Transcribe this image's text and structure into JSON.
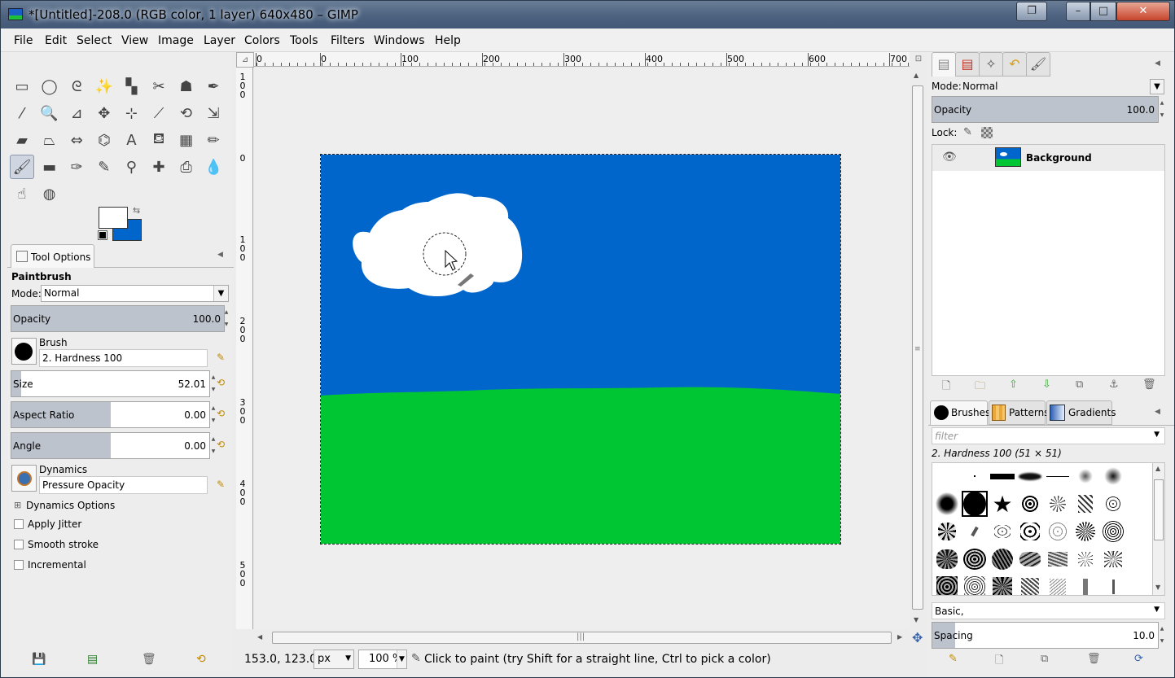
{
  "window": {
    "title": "*[Untitled]-208.0 (RGB color, 1 layer) 640x480 – GIMP",
    "buttons": {
      "restore": "❐",
      "minimize": "–",
      "maximize": "□",
      "close": "✕"
    }
  },
  "menubar": {
    "items": [
      "File",
      "Edit",
      "Select",
      "View",
      "Image",
      "Layer",
      "Colors",
      "Tools",
      "Filters",
      "Windows",
      "Help"
    ]
  },
  "toolbox": {
    "tools": [
      {
        "name": "rect-select-icon",
        "glyph": "▭"
      },
      {
        "name": "ellipse-select-icon",
        "glyph": "◯"
      },
      {
        "name": "free-select-icon",
        "glyph": "ᘓ"
      },
      {
        "name": "fuzzy-select-icon",
        "glyph": "✨"
      },
      {
        "name": "select-by-color-icon",
        "glyph": "▚"
      },
      {
        "name": "scissors-select-icon",
        "glyph": "✂"
      },
      {
        "name": "foreground-select-icon",
        "glyph": "☗"
      },
      {
        "name": "paths-icon",
        "glyph": "✒"
      },
      {
        "name": "color-picker-icon",
        "glyph": "⁄"
      },
      {
        "name": "zoom-icon",
        "glyph": "🔍"
      },
      {
        "name": "measure-icon",
        "glyph": "⊿"
      },
      {
        "name": "move-icon",
        "glyph": "✥"
      },
      {
        "name": "align-icon",
        "glyph": "⊹"
      },
      {
        "name": "crop-icon",
        "glyph": "⟋"
      },
      {
        "name": "rotate-icon",
        "glyph": "⟲"
      },
      {
        "name": "scale-icon",
        "glyph": "⇲"
      },
      {
        "name": "shear-icon",
        "glyph": "▰"
      },
      {
        "name": "perspective-icon",
        "glyph": "⏢"
      },
      {
        "name": "flip-icon",
        "glyph": "⇔"
      },
      {
        "name": "cage-transform-icon",
        "glyph": "⌬"
      },
      {
        "name": "text-icon",
        "glyph": "A"
      },
      {
        "name": "bucket-fill-icon",
        "glyph": "⛾"
      },
      {
        "name": "blend-icon",
        "glyph": "▦"
      },
      {
        "name": "pencil-icon",
        "glyph": "✏"
      },
      {
        "name": "paintbrush-icon",
        "glyph": "🖌"
      },
      {
        "name": "eraser-icon",
        "glyph": "▬"
      },
      {
        "name": "airbrush-icon",
        "glyph": "✑"
      },
      {
        "name": "ink-icon",
        "glyph": "✎"
      },
      {
        "name": "clone-icon",
        "glyph": "⚲"
      },
      {
        "name": "heal-icon",
        "glyph": "✚"
      },
      {
        "name": "perspective-clone-icon",
        "glyph": "⎙"
      },
      {
        "name": "blur-sharpen-icon",
        "glyph": "💧"
      },
      {
        "name": "smudge-icon",
        "glyph": "☝"
      },
      {
        "name": "dodge-burn-icon",
        "glyph": "◍"
      }
    ],
    "selected_tool": "paintbrush-icon",
    "fg_color": "#ffffff",
    "bg_color": "#0066cc"
  },
  "tool_options": {
    "tab_label": "Tool Options",
    "tool_name": "Paintbrush",
    "mode_label": "Mode:",
    "mode_value": "Normal",
    "opacity_label": "Opacity",
    "opacity_value": "100.0",
    "opacity": 1.0,
    "brush_label": "Brush",
    "brush_value": "2. Hardness 100",
    "size_label": "Size",
    "size_value": "52.01",
    "size_fraction": 0.05,
    "aspect_label": "Aspect Ratio",
    "aspect_value": "0.00",
    "aspect_fraction": 0.5,
    "angle_label": "Angle",
    "angle_value": "0.00",
    "angle_fraction": 0.5,
    "dynamics_label": "Dynamics",
    "dynamics_value": "Pressure Opacity",
    "dynamics_options": "Dynamics Options",
    "checkboxes": [
      "Apply Jitter",
      "Smooth stroke",
      "Incremental"
    ]
  },
  "ruler": {
    "h_labels": [
      "0",
      "0",
      "100",
      "200",
      "300",
      "400",
      "500",
      "600",
      "700"
    ],
    "v_labels": [
      "100",
      "0",
      "100",
      "200",
      "300",
      "400",
      "500"
    ]
  },
  "canvas": {
    "sky_color": "#0066cc",
    "grass_color": "#00c634",
    "cloud_color": "#ffffff"
  },
  "status": {
    "coords": "153.0, 123.0",
    "unit": "px",
    "zoom": "100 %",
    "message": "Click to paint (try Shift for a straight line, Ctrl to pick a color)"
  },
  "layers_dock": {
    "tabs": [
      "layers-icon",
      "channels-icon",
      "paths-icon",
      "undo-history-icon",
      "brush-tab-icon"
    ],
    "mode_label": "Mode:",
    "mode_value": "Normal",
    "opacity_label": "Opacity",
    "opacity_value": "100.0",
    "lock_label": "Lock:",
    "layer_name": "Background"
  },
  "brushes_dock": {
    "tabs": [
      "Brushes",
      "Patterns",
      "Gradients"
    ],
    "filter_placeholder": "filter",
    "brush_info": "2. Hardness 100 (51 × 51)",
    "tag_value": "Basic,",
    "spacing_label": "Spacing",
    "spacing_value": "10.0",
    "spacing_fraction": 0.1
  }
}
